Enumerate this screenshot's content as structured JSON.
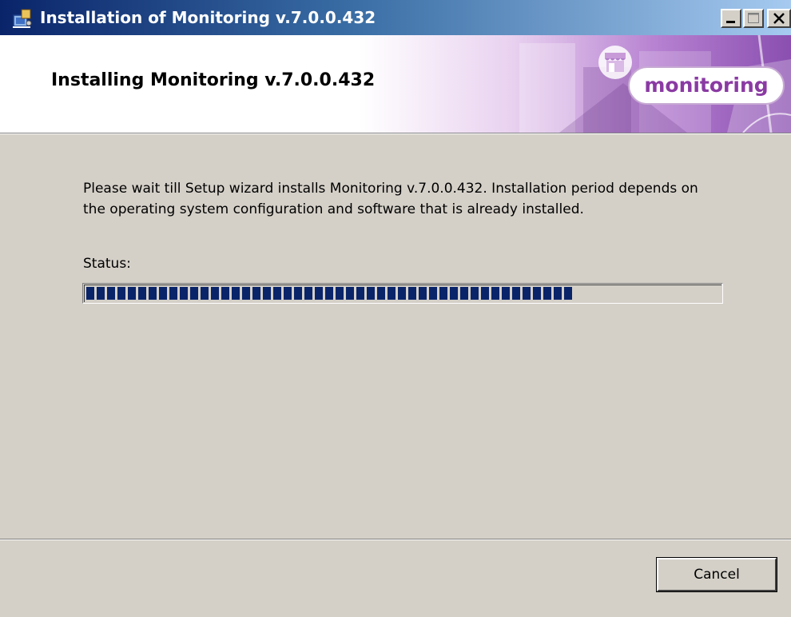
{
  "window": {
    "title": "Installation of Monitoring v.7.0.0.432",
    "icons": {
      "app": "installer-icon",
      "minimize": "minimize-icon",
      "maximize": "maximize-icon",
      "close": "close-icon"
    }
  },
  "header": {
    "heading": "Installing Monitoring v.7.0.0.432",
    "brand": "monitoring",
    "brand_icon": "store-icon",
    "brand_color": "#8a3aa3"
  },
  "body": {
    "message": "Please wait till Setup wizard installs Monitoring v.7.0.0.432. Installation period depends on the operating system configuration and software that is already installed.",
    "status_label": "Status:",
    "progress_fraction": 0.78,
    "progress_color": "#0a246a"
  },
  "footer": {
    "cancel_label": "Cancel"
  }
}
